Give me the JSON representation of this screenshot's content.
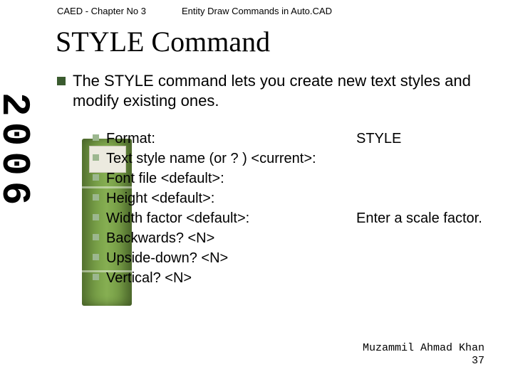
{
  "header": {
    "left": "CAED - Chapter No 3",
    "right": "Entity Draw Commands in Auto.CAD"
  },
  "title": "STYLE Command",
  "year": "2006",
  "main": {
    "text": "The STYLE command lets you create new text styles and modify existing ones."
  },
  "sub": [
    {
      "left": "Format:",
      "right": "STYLE"
    },
    {
      "left": "Text style name (or ? ) <current>:",
      "right": ""
    },
    {
      "left": "Font file <default>:",
      "right": ""
    },
    {
      "left": "Height <default>:",
      "right": ""
    },
    {
      "left": "Width factor <default>:",
      "right": "Enter a scale factor."
    },
    {
      "left": "Backwards? <N>",
      "right": ""
    },
    {
      "left": "Upside-down? <N>",
      "right": ""
    },
    {
      "left": "Vertical? <N>",
      "right": ""
    }
  ],
  "footer": {
    "author": "Muzammil Ahmad Khan",
    "page": "37"
  }
}
